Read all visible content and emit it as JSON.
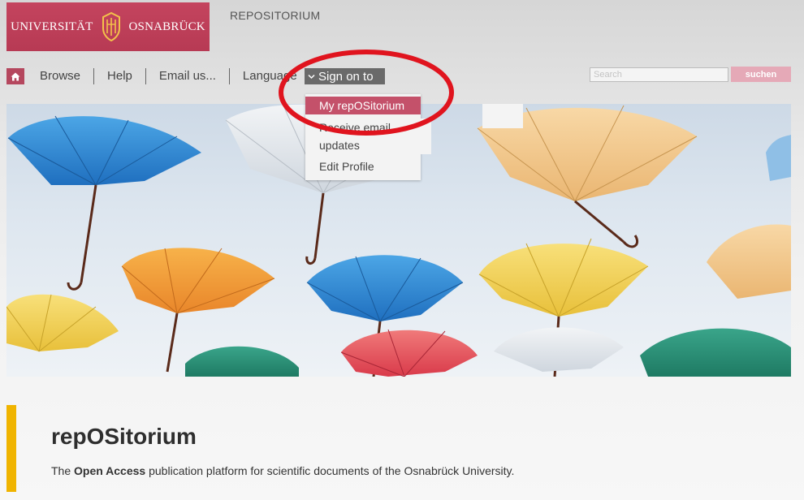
{
  "header": {
    "logo_left": "UNIVERSITÄT",
    "logo_right": "OSNABRÜCK",
    "site_title": "REPOSITORIUM",
    "brand_color": "#b73a54"
  },
  "nav": {
    "home_icon": "home-icon",
    "items": [
      {
        "label": "Browse"
      },
      {
        "label": "Help"
      },
      {
        "label": "Email us..."
      },
      {
        "label": "Language"
      }
    ],
    "signon_label": "Sign on to"
  },
  "search": {
    "placeholder": "Search",
    "button_label": "suchen"
  },
  "dropdown": {
    "items": [
      {
        "label": "My repOSitorium",
        "active": true
      },
      {
        "label": "Receive email updates"
      },
      {
        "label": "Edit Profile"
      }
    ]
  },
  "hero": {
    "description": "umbrellas"
  },
  "main": {
    "heading": "repOSitorium",
    "tagline_pre": "The ",
    "tagline_bold": "Open Access",
    "tagline_post": " publication platform for scientific documents of the Osnabrück University.",
    "accent_color": "#f0b400"
  },
  "annotation": {
    "color": "#e0141e"
  }
}
